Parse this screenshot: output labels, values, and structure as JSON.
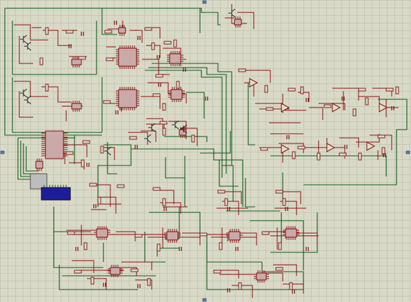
{
  "app": {
    "title": ""
  },
  "canvas": {
    "background": "#d9d9c7",
    "grid_color": "#b7b7a5",
    "wire_green": "#0f5a1a",
    "wire_red": "#8a1010",
    "component_red": "#7a1010",
    "lcd_blue": "#1d1d9a",
    "grid_visible": true
  },
  "icons": [
    "resistor-icon",
    "capacitor-icon",
    "ic-chip-icon",
    "transistor-icon",
    "opamp-icon",
    "lcd-icon",
    "selection-handle-icon"
  ]
}
